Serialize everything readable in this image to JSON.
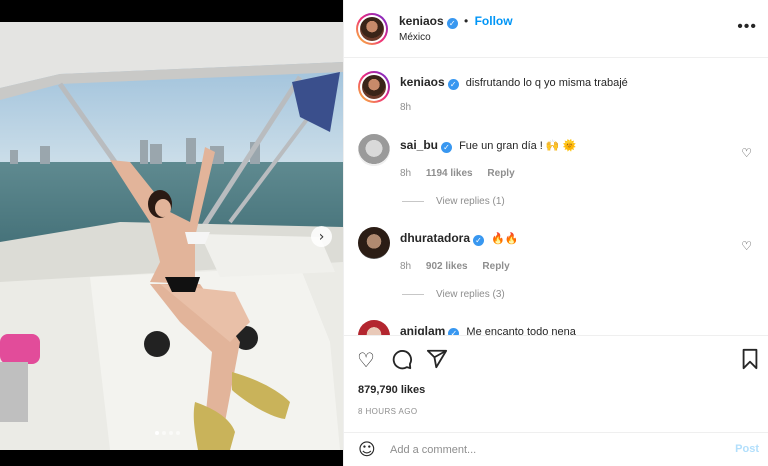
{
  "post": {
    "username": "keniaos",
    "follow_label": "Follow",
    "separator": "•",
    "location": "México",
    "more_label": "•••",
    "next_label": "›",
    "carousel": {
      "count": 4,
      "active": 0
    }
  },
  "caption": {
    "username": "keniaos",
    "text": "disfrutando lo q yo misma trabajé",
    "time": "8h"
  },
  "comments": [
    {
      "username": "sai_bu",
      "text": "Fue un gran día ! 🙌 🌞",
      "time": "8h",
      "likes": "1194 likes",
      "reply": "Reply",
      "view_replies": "View replies (1)"
    },
    {
      "username": "dhuratadora",
      "text": "🔥🔥",
      "time": "8h",
      "likes": "902 likes",
      "reply": "Reply",
      "view_replies": "View replies (3)"
    },
    {
      "username": "aniglam",
      "text": "Me encanto todo nena"
    }
  ],
  "actions": {
    "likes": "879,790 likes",
    "posted": "8 HOURS AGO",
    "icons": [
      "heart-icon",
      "comment-icon",
      "share-icon",
      "bookmark-icon"
    ]
  },
  "add_comment": {
    "placeholder": "Add a comment...",
    "post_label": "Post"
  },
  "colors": {
    "accent": "#0095f6",
    "verified": "#3897f0",
    "muted": "#8e8e8e"
  }
}
